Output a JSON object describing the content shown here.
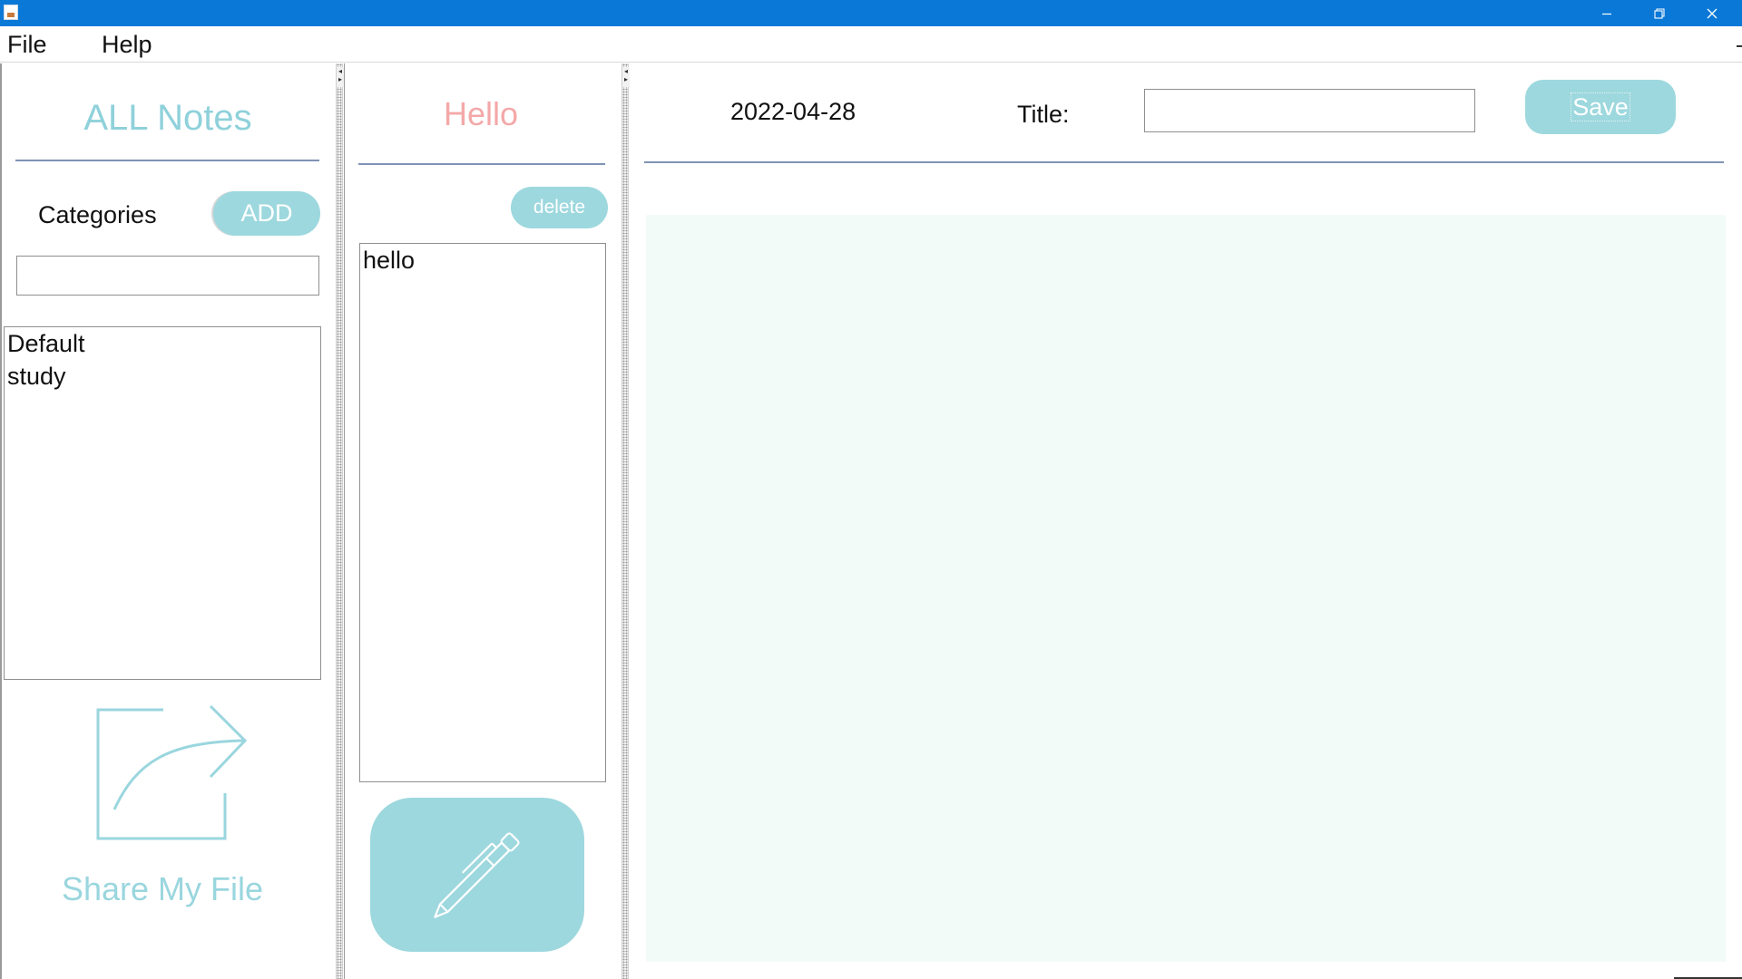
{
  "window": {
    "minimize_icon": "minimize-icon",
    "restore_icon": "restore-icon",
    "close_icon": "close-icon"
  },
  "menu": {
    "items": [
      {
        "label": "File"
      },
      {
        "label": "Help"
      }
    ]
  },
  "sidebar": {
    "heading": "ALL Notes",
    "categories_label": "Categories",
    "add_label": "ADD",
    "category_input_value": "",
    "categories": [
      {
        "label": "Default"
      },
      {
        "label": "study"
      }
    ],
    "share_icon": "share-icon",
    "share_label": "Share My File"
  },
  "notes_pane": {
    "current_note_title": "Hello",
    "delete_label": "delete",
    "notes": [
      {
        "label": "hello"
      }
    ],
    "edit_icon": "pen-icon"
  },
  "editor": {
    "date": "2022-04-28",
    "title_label": "Title:",
    "title_value": "",
    "save_label": "Save",
    "content": ""
  },
  "colors": {
    "titlebar": "#0a78d7",
    "accent": "#9dd8de",
    "heading_teal": "#8fd1db",
    "note_title_pink": "#f4a8a8",
    "editor_bg": "#f3fbf8",
    "divider_line": "#7f93b5"
  }
}
